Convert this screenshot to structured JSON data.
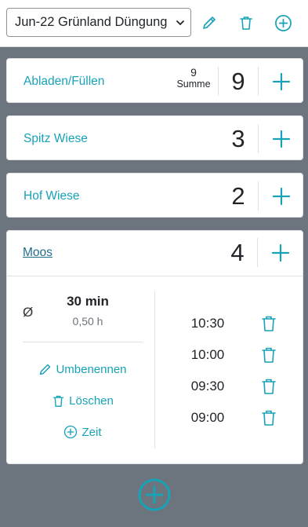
{
  "header": {
    "selected_event": "Jun-22 Grünland Düngung",
    "icons": [
      "pencil-icon",
      "trash-icon",
      "plus-circle-icon"
    ]
  },
  "cards": [
    {
      "label": "Abladen/Füllen",
      "count": "9",
      "sum_value": "9",
      "sum_label": "Summe"
    },
    {
      "label": "Spitz Wiese",
      "count": "3"
    },
    {
      "label": "Hof Wiese",
      "count": "2"
    },
    {
      "label": "Moos",
      "count": "4"
    }
  ],
  "detail": {
    "avg_symbol": "Ø",
    "avg_duration": "30 min",
    "avg_hours": "0,50 h",
    "actions": {
      "rename": "Umbenennen",
      "delete": "Löschen",
      "add_time": "Zeit"
    },
    "times": [
      "10:30",
      "10:00",
      "09:30",
      "09:00"
    ]
  },
  "colors": {
    "accent": "#17a2b8",
    "background": "#6c757d",
    "link": "#1f6d8a"
  }
}
